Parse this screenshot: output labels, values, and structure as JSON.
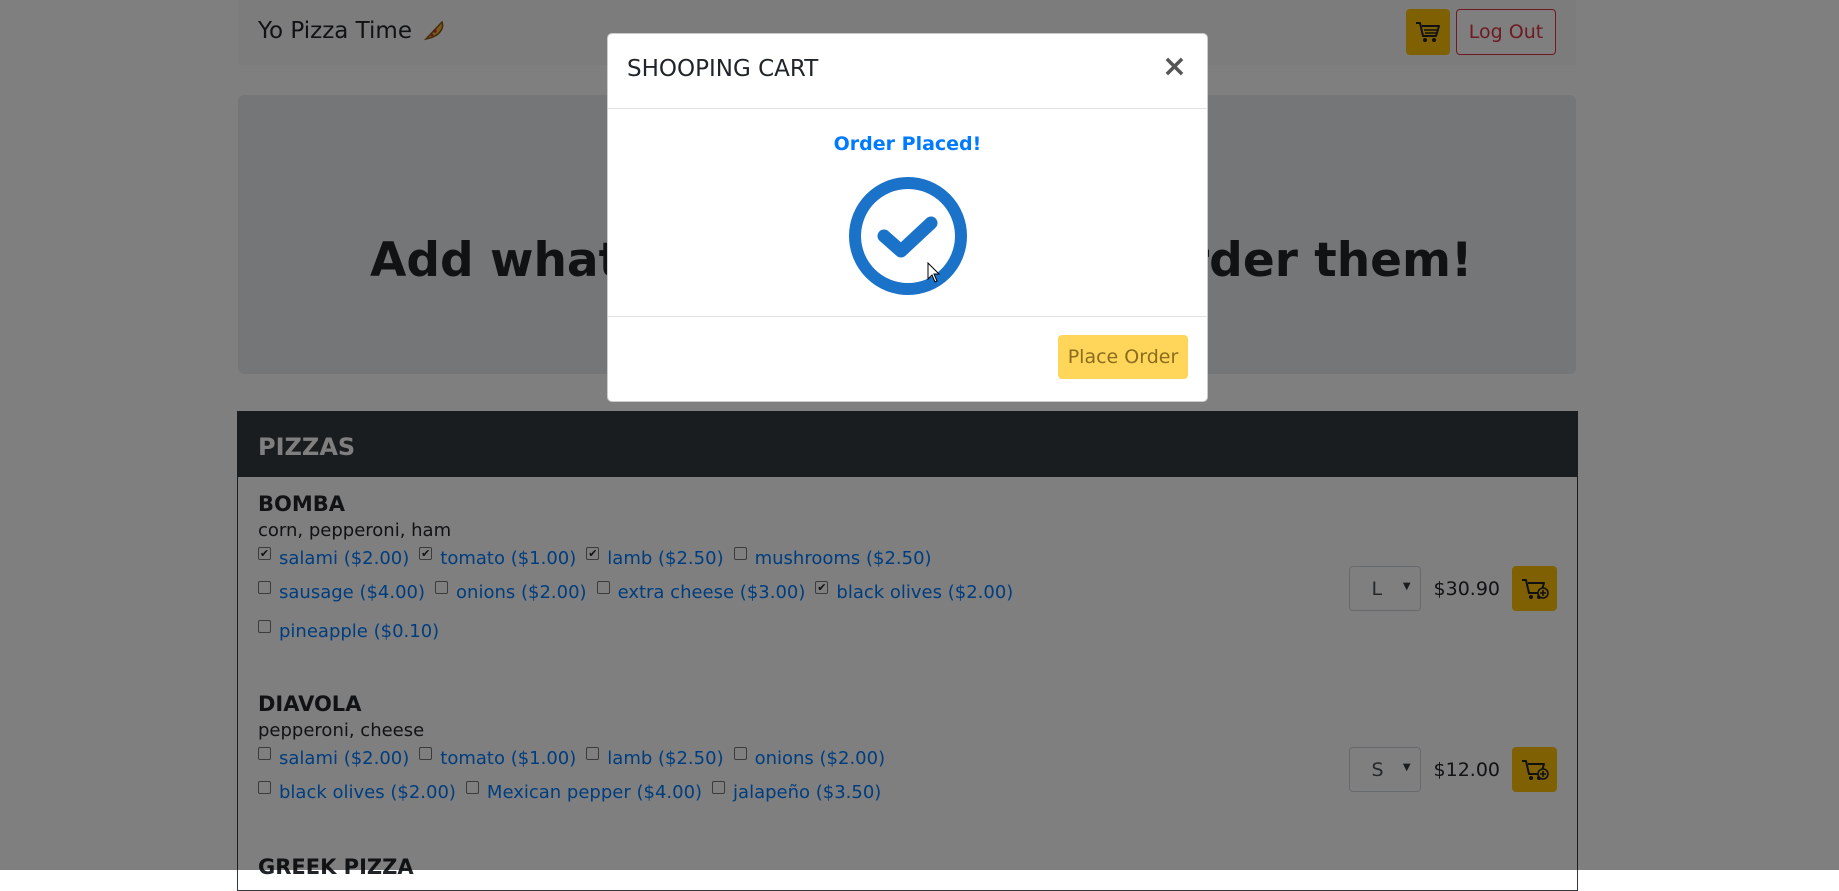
{
  "navbar": {
    "brand": "Yo Pizza Time",
    "logout_label": "Log Out"
  },
  "jumbotron": {
    "left_text": "Add what y",
    "right_text": "rder them!"
  },
  "pizzas": {
    "header": "PIZZAS",
    "items": [
      {
        "name": "BOMBA",
        "description": "corn, pepperoni, ham",
        "toppings_rows": [
          [
            {
              "label": "salami ($2.00)",
              "checked": true
            },
            {
              "label": "tomato ($1.00)",
              "checked": true
            },
            {
              "label": "lamb ($2.50)",
              "checked": true
            },
            {
              "label": "mushrooms ($2.50)",
              "checked": false
            }
          ],
          [
            {
              "label": "sausage ($4.00)",
              "checked": false
            },
            {
              "label": "onions ($2.00)",
              "checked": false
            },
            {
              "label": "extra cheese ($3.00)",
              "checked": false
            },
            {
              "label": "black olives ($2.00)",
              "checked": true
            }
          ],
          [
            {
              "label": "pineapple ($0.10)",
              "checked": false
            }
          ]
        ],
        "size": "L",
        "price": "$30.90"
      },
      {
        "name": "DIAVOLA",
        "description": "pepperoni, cheese",
        "toppings_rows": [
          [
            {
              "label": "salami ($2.00)",
              "checked": false
            },
            {
              "label": "tomato ($1.00)",
              "checked": false
            },
            {
              "label": "lamb ($2.50)",
              "checked": false
            },
            {
              "label": "onions ($2.00)",
              "checked": false
            }
          ],
          [
            {
              "label": "black olives ($2.00)",
              "checked": false
            },
            {
              "label": "Mexican pepper ($4.00)",
              "checked": false
            },
            {
              "label": "jalapeño ($3.50)",
              "checked": false
            }
          ]
        ],
        "size": "S",
        "price": "$12.00"
      },
      {
        "name": "GREEK PIZZA"
      }
    ]
  },
  "modal": {
    "title": "SHOOPING CART",
    "close": "×",
    "status": "Order Placed!",
    "place_order_label": "Place Order"
  },
  "colors": {
    "primary": "#007bff",
    "warning": "#ffc107",
    "danger": "#dc3545",
    "dark": "#343a40"
  }
}
